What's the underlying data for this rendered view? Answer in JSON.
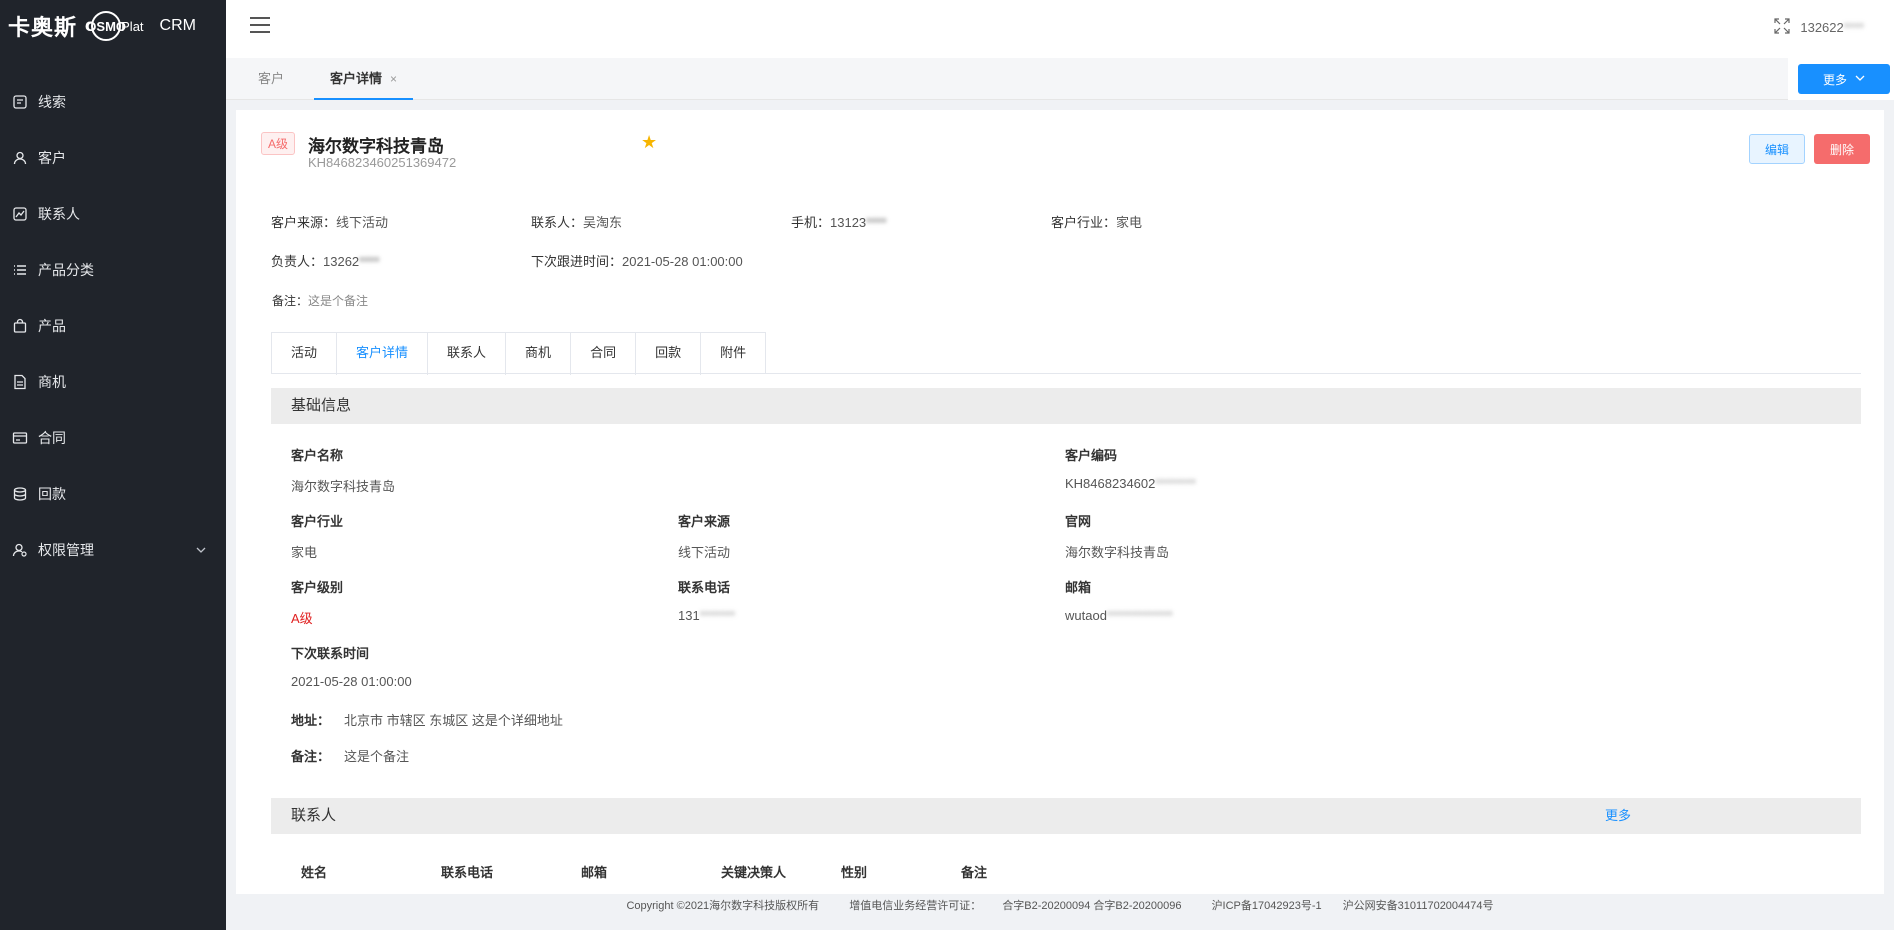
{
  "brand": {
    "cn": "卡奥斯",
    "cosmo_left": "C",
    "cosmo_ring": "OSMO",
    "plat": "Plat",
    "crm": "CRM"
  },
  "sidebar": {
    "items": [
      {
        "label": "线索",
        "icon": "leads-icon"
      },
      {
        "label": "客户",
        "icon": "user-icon"
      },
      {
        "label": "联系人",
        "icon": "contact-icon"
      },
      {
        "label": "产品分类",
        "icon": "list-icon"
      },
      {
        "label": "产品",
        "icon": "bag-icon"
      },
      {
        "label": "商机",
        "icon": "doc-icon"
      },
      {
        "label": "合同",
        "icon": "contract-icon"
      },
      {
        "label": "回款",
        "icon": "database-icon"
      },
      {
        "label": "权限管理",
        "icon": "user-manage-icon"
      }
    ]
  },
  "header": {
    "user": "132622",
    "user_blur": "****"
  },
  "page_tabs": {
    "tab1": "客户",
    "tab2": "客户详情",
    "close": "×",
    "more": "更多"
  },
  "customer": {
    "level_tag": "A级",
    "name": "海尔数字科技青岛",
    "code": "KH846823460251369472",
    "edit": "编辑",
    "delete": "删除"
  },
  "summary": {
    "source_label": "客户来源：",
    "source": "线下活动",
    "contact_label": "联系人：",
    "contact": "吴淘东",
    "mobile_label": "手机：",
    "mobile": "13123",
    "mobile_blur": "****",
    "industry_label": "客户行业：",
    "industry": "家电",
    "owner_label": "负责人：",
    "owner": "13262",
    "owner_blur": "****",
    "next_label": "下次跟进时间：",
    "next": "2021-05-28 01:00:00",
    "remark_label": "备注：",
    "remark": "这是个备注"
  },
  "detail_tabs": [
    "活动",
    "客户详情",
    "联系人",
    "商机",
    "合同",
    "回款",
    "附件"
  ],
  "basic": {
    "title": "基础信息",
    "name_label": "客户名称",
    "name": "海尔数字科技青岛",
    "code_label": "客户编码",
    "code": "KH8468234602",
    "code_blur": "********",
    "industry_label": "客户行业",
    "industry": "家电",
    "source_label": "客户来源",
    "source": "线下活动",
    "website_label": "官网",
    "website": "海尔数字科技青岛",
    "level_label": "客户级别",
    "level": "A级",
    "phone_label": "联系电话",
    "phone": "131",
    "phone_blur": "*******",
    "email_label": "邮箱",
    "email": "wutaod",
    "email_blur": "*************",
    "next_label": "下次联系时间",
    "next": "2021-05-28 01:00:00",
    "address_label": "地址：",
    "address": "北京市 市辖区 东城区 这是个详细地址",
    "remark_label": "备注：",
    "remark": "这是个备注"
  },
  "contacts": {
    "title": "联系人",
    "more": "更多",
    "columns": [
      "姓名",
      "联系电话",
      "邮箱",
      "关键决策人",
      "性别",
      "备注"
    ]
  },
  "footer": {
    "copyright": "Copyright ©2021海尔数字科技版权所有",
    "license": "增值电信业务经营许可证：",
    "lic1": "合字B2-20200094 合字B2-20200096",
    "icp": "沪ICP备17042923号-1",
    "police": "沪公网安备31011702004474号"
  }
}
